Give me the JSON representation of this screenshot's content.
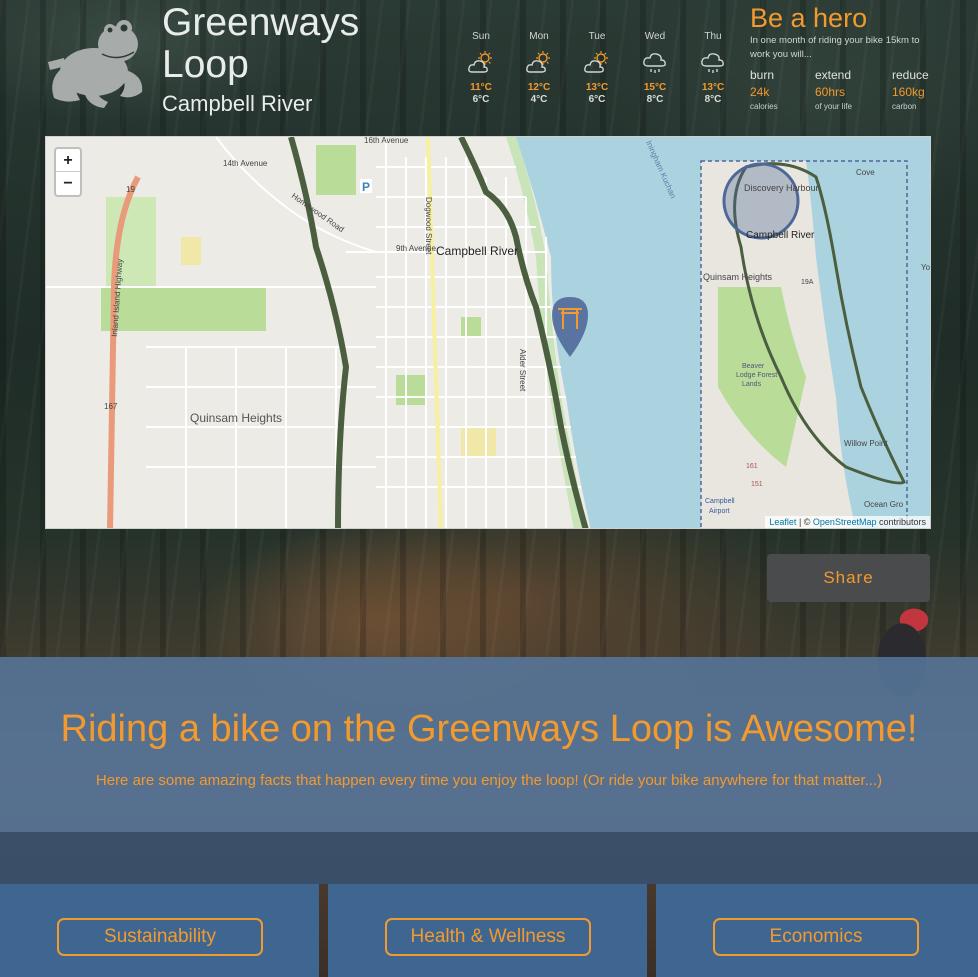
{
  "header": {
    "title_line1": "Greenways",
    "title_line2": "Loop",
    "subtitle": "Campbell River",
    "logo_icon": "frog-icon"
  },
  "weather": [
    {
      "day": "Sun",
      "icon": "partly-sunny-icon",
      "high": "11°C",
      "low": "6°C"
    },
    {
      "day": "Mon",
      "icon": "partly-sunny-icon",
      "high": "12°C",
      "low": "4°C"
    },
    {
      "day": "Tue",
      "icon": "partly-sunny-icon",
      "high": "13°C",
      "low": "6°C"
    },
    {
      "day": "Wed",
      "icon": "rain-icon",
      "high": "15°C",
      "low": "8°C"
    },
    {
      "day": "Thu",
      "icon": "rain-icon",
      "high": "13°C",
      "low": "8°C"
    }
  ],
  "hero": {
    "title": "Be a hero",
    "text": "In one month of riding your bike 15km to work you will...",
    "stats": [
      {
        "verb": "burn",
        "value": "24k",
        "unit": "calories"
      },
      {
        "verb": "extend",
        "value": "60hrs",
        "unit": "of your life"
      },
      {
        "verb": "reduce",
        "value": "160kg",
        "unit": "carbon"
      }
    ]
  },
  "map": {
    "zoom_in": "+",
    "zoom_out": "−",
    "labels": {
      "avenue_14": "14th Avenue",
      "avenue_16": "16th Avenue",
      "avenue_9": "9th Avenue",
      "homewood": "Homewood Road",
      "dogwood": "Dogwood Street",
      "alder": "Alder Street",
      "highway": "Inland Island Highway",
      "city": "Campbell River",
      "quinsam": "Quinsam Heights",
      "kuchan": "Iningham Kuchan",
      "route_19": "19",
      "route_167": "167"
    },
    "minimap_labels": {
      "discovery": "Discovery Harbour",
      "city": "Campbell River",
      "quinsam": "Quinsam Heights",
      "cove": "Cove",
      "forest_1": "Beaver",
      "forest_2": "Lodge Forest",
      "forest_3": "Lands",
      "willow": "Willow Point",
      "ocean": "Ocean Gro",
      "airport_1": "Campbell",
      "airport_2": "Airport",
      "route_19a": "19A",
      "route_161": "161",
      "route_151": "151",
      "yo": "Yo"
    },
    "attribution_leaflet": "Leaflet",
    "attribution_sep": " | © ",
    "attribution_osm": "OpenStreetMap",
    "attribution_tail": " contributors",
    "marker_icon": "torii-gate-marker-icon"
  },
  "share_label": "Share",
  "band": {
    "title": "Riding a bike on the Greenways Loop is Awesome!",
    "subtitle": "Here are some amazing facts that happen every time you enjoy the loop! (Or ride your bike anywhere for that matter...)"
  },
  "cards": [
    {
      "label": "Sustainability"
    },
    {
      "label": "Health & Wellness"
    },
    {
      "label": "Economics"
    }
  ],
  "colors": {
    "accent": "#f29a2e",
    "band": "#56769c",
    "card": "#3f6691",
    "share_bg": "#4a4b4d",
    "water": "#aad3df",
    "route": "#4b5e3f"
  }
}
